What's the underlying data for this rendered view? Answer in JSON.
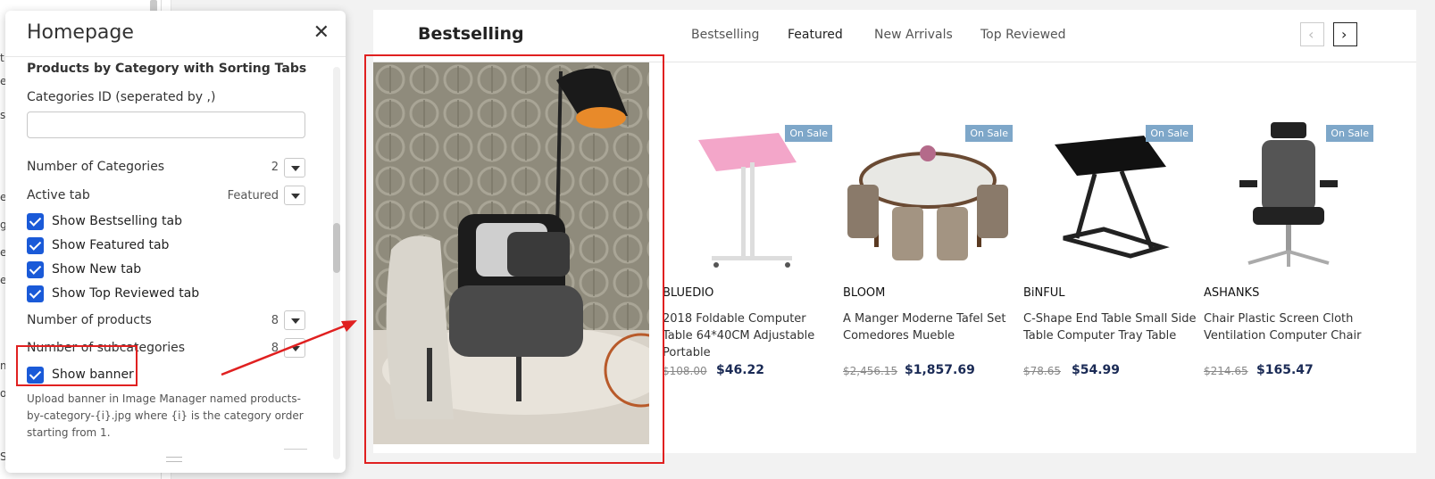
{
  "panel": {
    "title": "Homepage",
    "close_icon": "close-icon",
    "section_title": "Products by Category with Sorting Tabs",
    "categories_label": "Categories ID (seperated by ,)",
    "categories_value": "",
    "num_categories_label": "Number of Categories",
    "num_categories_value": "2",
    "active_tab_label": "Active tab",
    "active_tab_value": "Featured",
    "checks": [
      {
        "label": "Show Bestselling tab",
        "checked": true
      },
      {
        "label": "Show Featured tab",
        "checked": true
      },
      {
        "label": "Show New tab",
        "checked": true
      },
      {
        "label": "Show Top Reviewed tab",
        "checked": true
      }
    ],
    "num_products_label": "Number of products",
    "num_products_value": "8",
    "num_subcategories_label": "Number of subcategories",
    "num_subcategories_value": "8",
    "show_banner_label": "Show banner",
    "help_text": "Upload banner in Image Manager named products-by-category-{i}.jpg where {i} is the category order starting from 1."
  },
  "shop": {
    "title": "Bestselling",
    "tabs": [
      "Bestselling",
      "Featured",
      "New Arrivals",
      "Top Reviewed"
    ],
    "active_tab": "Featured",
    "prev_icon": "chevron-left-icon",
    "next_icon": "chevron-right-icon",
    "products": [
      {
        "badge": "On Sale",
        "brand": "BLUEDIO",
        "name": "2018 Foldable Computer Table 64*40CM Adjustable Portable",
        "old_price": "$108.00",
        "price": "$46.22"
      },
      {
        "badge": "On Sale",
        "brand": "BLOOM",
        "name": "A Manger Moderne Tafel Set Comedores Mueble",
        "old_price": "$2,456.15",
        "price": "$1,857.69"
      },
      {
        "badge": "On Sale",
        "brand": "BiNFUL",
        "name": "C-Shape End Table Small Side Table Computer Tray Table",
        "old_price": "$78.65",
        "price": "$54.99"
      },
      {
        "badge": "On Sale",
        "brand": "ASHANKS",
        "name": "Chair Plastic Screen Cloth Ventilation Computer Chair",
        "old_price": "$214.65",
        "price": "$165.47"
      }
    ]
  },
  "colors": {
    "accent": "#1a5ad8",
    "highlight": "#e02020",
    "sale_badge": "#7ea7c9",
    "price": "#1a2a55"
  }
}
